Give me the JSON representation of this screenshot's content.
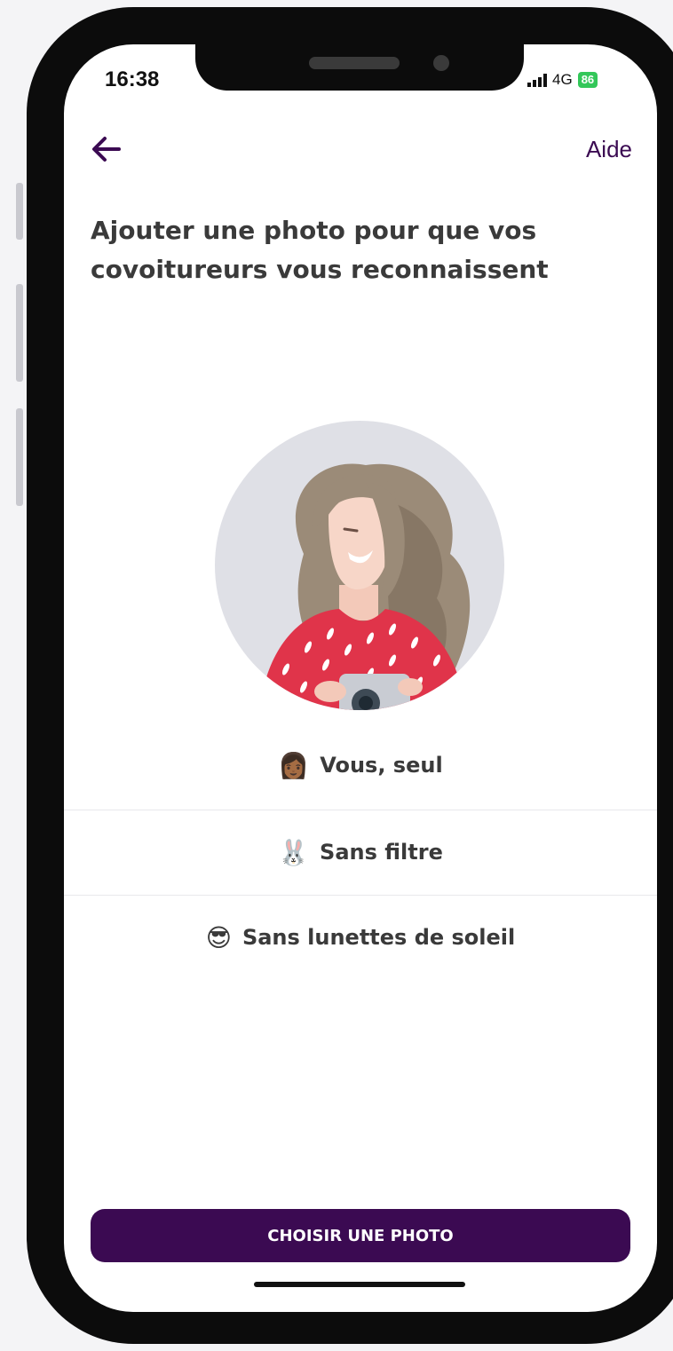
{
  "status_bar": {
    "time": "16:38",
    "network": "4G",
    "battery": "86"
  },
  "header": {
    "back_icon": "arrow-left-icon",
    "help_label": "Aide"
  },
  "title": "Ajouter une photo pour que vos covoitureurs vous reconnaissent",
  "guidelines": [
    {
      "emoji": "👩🏾",
      "label": "Vous, seul"
    },
    {
      "emoji": "🐰",
      "label": "Sans filtre"
    },
    {
      "emoji": "😎",
      "label": "Sans lunettes de soleil"
    }
  ],
  "cta_label": "CHOISIR UNE PHOTO",
  "colors": {
    "brand": "#3b0a52",
    "text": "#3a3a3a",
    "avatar_bg": "#dfe0e6",
    "hair": "#9b8b78",
    "sweater": "#e0344a"
  }
}
